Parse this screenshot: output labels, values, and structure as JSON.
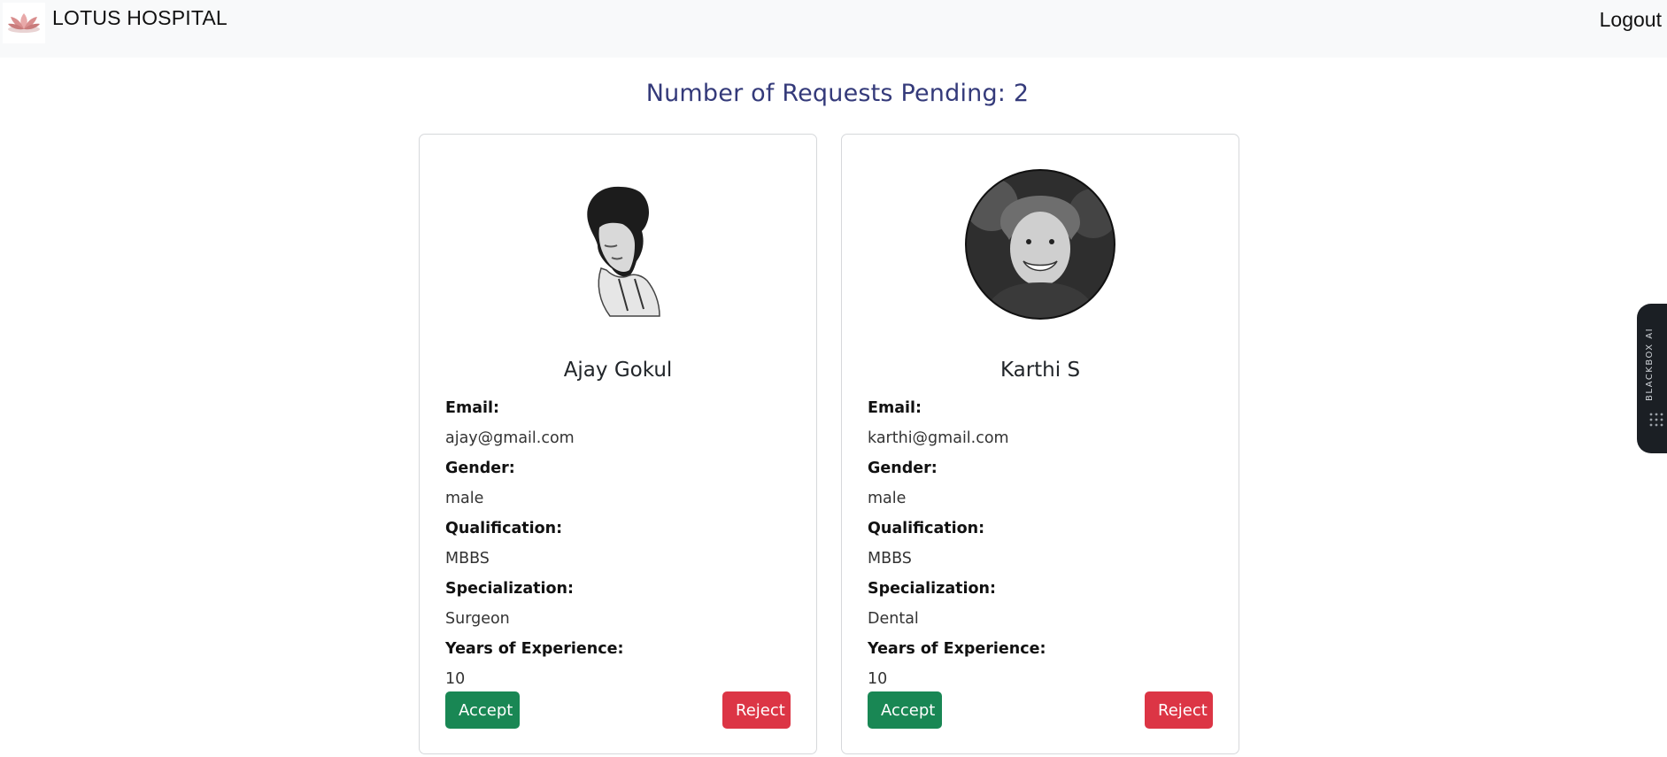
{
  "app": {
    "brand": "LOTUS HOSPITAL",
    "logout_label": "Logout"
  },
  "heading": "Number of Requests Pending: 2",
  "field_labels": {
    "email": "Email:",
    "gender": "Gender:",
    "qualification": "Qualification:",
    "specialization": "Specialization:",
    "experience": "Years of Experience:"
  },
  "requests": [
    {
      "name": "Ajay Gokul",
      "email": "ajay@gmail.com",
      "gender": "male",
      "qualification": "MBBS",
      "specialization": "Surgeon",
      "experience": "10",
      "accept_label": "Accept",
      "reject_label": "Reject"
    },
    {
      "name": "Karthi S",
      "email": "karthi@gmail.com",
      "gender": "male",
      "qualification": "MBBS",
      "specialization": "Dental",
      "experience": "10",
      "accept_label": "Accept",
      "reject_label": "Reject"
    }
  ],
  "side_tab": {
    "label": "BLACKBOX AI"
  },
  "colors": {
    "heading": "#343a7a",
    "accept": "#198754",
    "reject": "#dc3545",
    "navbar_bg": "#f8f9fa"
  }
}
